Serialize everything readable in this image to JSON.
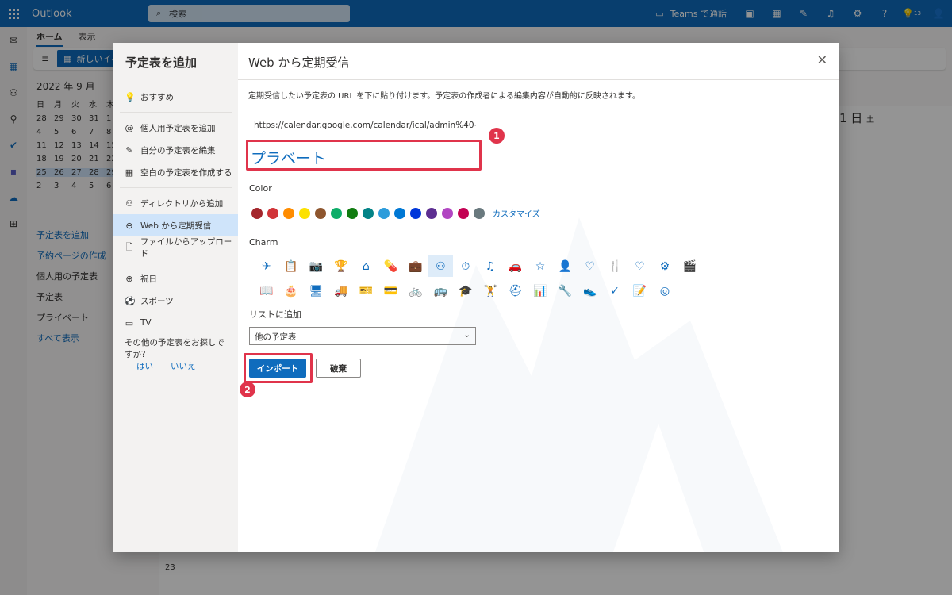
{
  "app": {
    "name": "Outlook"
  },
  "search": {
    "placeholder": "検索"
  },
  "topbar": {
    "teams_call": "Teams で通話",
    "notif_count": "13"
  },
  "ribbon": {
    "tabs": [
      "ホーム",
      "表示"
    ],
    "new_event": "新しいイベ"
  },
  "minical": {
    "month": "2022 年 9 月",
    "weekdays": [
      "日",
      "月",
      "火",
      "水",
      "木"
    ],
    "days": [
      "28",
      "29",
      "30",
      "31",
      "1",
      "4",
      "5",
      "6",
      "7",
      "8",
      "11",
      "12",
      "13",
      "14",
      "15",
      "18",
      "19",
      "20",
      "21",
      "22",
      "25",
      "26",
      "27",
      "28",
      "29",
      "2",
      "3",
      "4",
      "5",
      "6"
    ]
  },
  "leftnav": {
    "add_calendar": "予定表を追加",
    "booking": "予約ページの作成",
    "my_calendars": "個人用の予定表",
    "calendar": "予定表",
    "private": "プライベート",
    "show_all": "すべて表示"
  },
  "grid": {
    "day_header": "1 日",
    "day_sub": "土",
    "week_no": "23"
  },
  "dialog": {
    "left_title": "予定表を追加",
    "nav": [
      {
        "icon": "💡",
        "label": "おすすめ"
      },
      {
        "icon": "@",
        "label": "個人用予定表を追加"
      },
      {
        "icon": "✎",
        "label": "自分の予定表を編集"
      },
      {
        "icon": "▦",
        "label": "空白の予定表を作成する"
      },
      {
        "icon": "⚇",
        "label": "ディレクトリから追加"
      },
      {
        "icon": "⊖",
        "label": "Web から定期受信"
      },
      {
        "icon": "🗋",
        "label": "ファイルからアップロード"
      },
      {
        "icon": "⊕",
        "label": "祝日"
      },
      {
        "icon": "⚽",
        "label": "スポーツ"
      },
      {
        "icon": "▭",
        "label": "TV"
      }
    ],
    "more_question": "その他の予定表をお探しですか?",
    "yes": "はい",
    "no": "いいえ",
    "title": "Web から定期受信",
    "description": "定期受信したい予定表の URL を下に貼り付けます。予定表の作成者による編集内容が自動的に反映されます。",
    "url_value": "https://calendar.google.com/calendar/ical/admin%40⋯",
    "name_value": "プラベート",
    "color_label": "Color",
    "colors": [
      "#a4262c",
      "#d13438",
      "#ff8c00",
      "#fce100",
      "#8e562e",
      "#0ead69",
      "#107c10",
      "#038387",
      "#2d9cdb",
      "#0078d4",
      "#0037da",
      "#5c2e91",
      "#b146c2",
      "#c30052",
      "#69797e"
    ],
    "customize": "カスタマイズ",
    "charm_label": "Charm",
    "charms": [
      "✈",
      "📋",
      "📷",
      "🏆",
      "⌂",
      "💊",
      "💼",
      "⚇",
      "⏱",
      "♫",
      "🚗",
      "☆",
      "👤",
      "♡",
      "🍴",
      "♡",
      "⚙",
      "🎬",
      "📖",
      "🎂",
      "🖥",
      "🚚",
      "🎫",
      "💳",
      "🚲",
      "🚌",
      "🎓",
      "🏋",
      "⛑",
      "📊",
      "🔧",
      "👟",
      "✓",
      "📝",
      "◎"
    ],
    "list_label": "リストに追加",
    "list_value": "他の予定表",
    "import": "インポート",
    "discard": "破棄",
    "badge1": "1",
    "badge2": "2"
  }
}
